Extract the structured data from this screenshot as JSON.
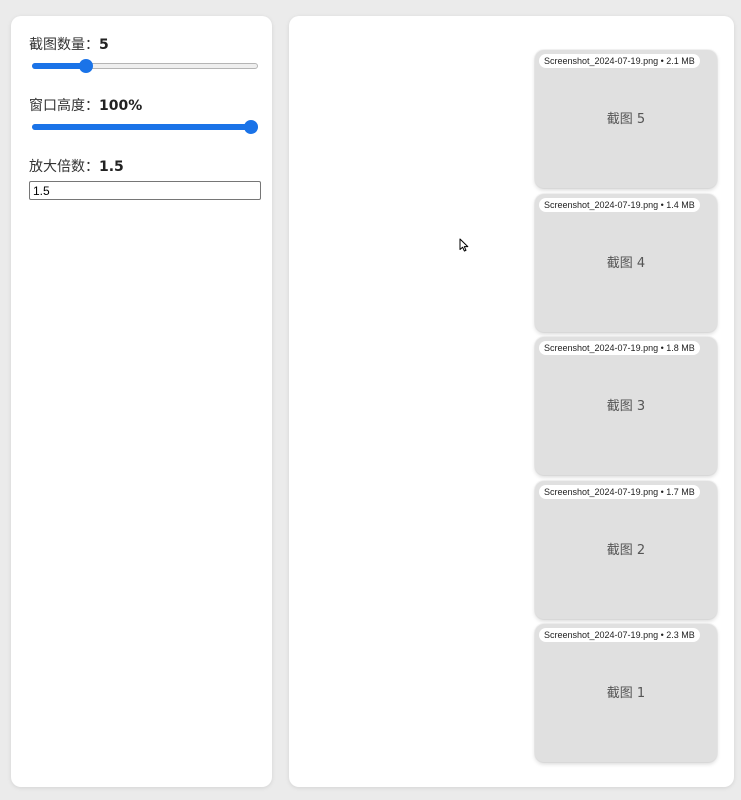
{
  "controls": {
    "count": {
      "label": "截图数量：",
      "value": "5",
      "fraction": 0.22
    },
    "height": {
      "label": "窗口高度：",
      "value": "100%",
      "fraction": 1.0
    },
    "zoom": {
      "label": "放大倍数：",
      "value": "1.5",
      "input_value": "1.5"
    }
  },
  "screenshots": [
    {
      "filename": "Screenshot_2024-07-19.png",
      "size": "2.1 MB",
      "label": "截图 5"
    },
    {
      "filename": "Screenshot_2024-07-19.png",
      "size": "1.4 MB",
      "label": "截图 4"
    },
    {
      "filename": "Screenshot_2024-07-19.png",
      "size": "1.8 MB",
      "label": "截图 3"
    },
    {
      "filename": "Screenshot_2024-07-19.png",
      "size": "1.7 MB",
      "label": "截图 2"
    },
    {
      "filename": "Screenshot_2024-07-19.png",
      "size": "2.3 MB",
      "label": "截图 1"
    }
  ],
  "separator": " • ",
  "colors": {
    "accent": "#1a73e8",
    "card_bg": "#e0e0e0",
    "page_bg": "#ebebeb"
  },
  "icons": {
    "cursor": "mouse-pointer-icon"
  }
}
